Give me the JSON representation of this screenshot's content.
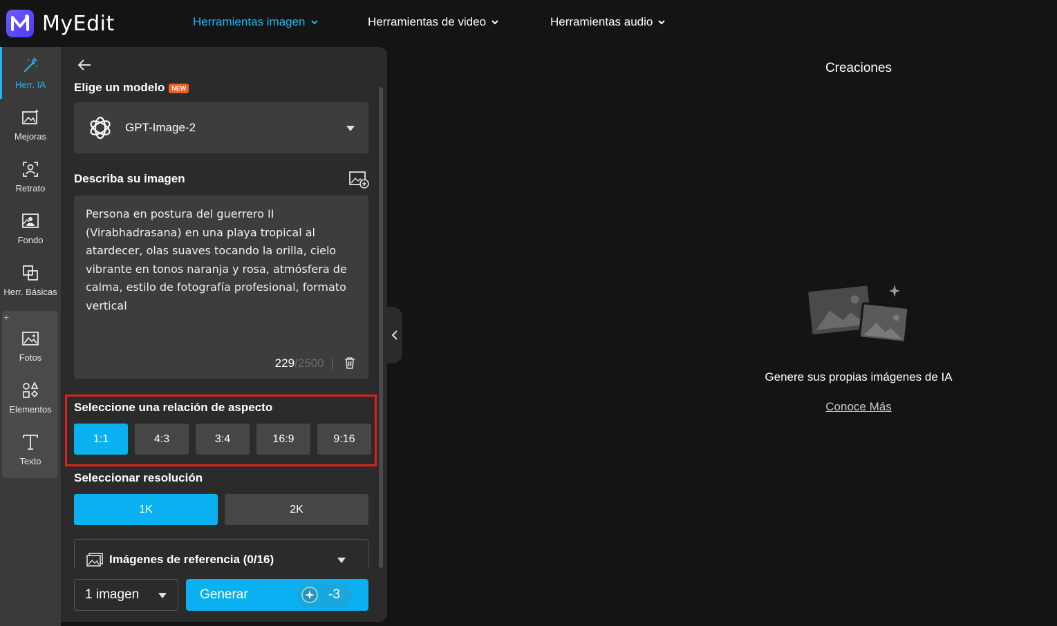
{
  "app": {
    "name": "MyEdit"
  },
  "nav": {
    "items": [
      {
        "label": "Herramientas imagen",
        "active": true
      },
      {
        "label": "Herramientas de video",
        "active": false
      },
      {
        "label": "Herramientas audio",
        "active": false
      }
    ]
  },
  "rail": {
    "items": [
      {
        "label": "Herr. IA",
        "icon": "magic-wand-icon",
        "active": true
      },
      {
        "label": "Mejoras",
        "icon": "image-enhance-icon"
      },
      {
        "label": "Retrato",
        "icon": "portrait-icon"
      },
      {
        "label": "Fondo",
        "icon": "background-icon"
      },
      {
        "label": "Herr. Básicas",
        "icon": "crop-icon"
      },
      {
        "label": "Fotos",
        "icon": "photo-icon"
      },
      {
        "label": "Elementos",
        "icon": "shapes-icon"
      },
      {
        "label": "Texto",
        "icon": "text-icon"
      }
    ],
    "plus": "+"
  },
  "panel": {
    "model_title": "Elige un modelo",
    "new_badge": "NEW",
    "model_selected": "GPT-Image-2",
    "describe_title": "Describa su imagen",
    "prompt": "Persona en postura del guerrero II (Virabhadrasana) en una playa tropical al atardecer, olas suaves tocando la orilla, cielo vibrante en tonos naranja y rosa, atmósfera de calma, estilo de fotografía profesional, formato vertical",
    "char_count": "229",
    "char_max": "/2500",
    "char_sep": "|",
    "aspect_title": "Seleccione una relación de aspecto",
    "aspect_options": [
      "1:1",
      "4:3",
      "3:4",
      "16:9",
      "9:16"
    ],
    "aspect_selected": "1:1",
    "resolution_title": "Seleccionar resolución",
    "resolution_options": [
      "1K",
      "2K"
    ],
    "resolution_selected": "1K",
    "reference_label": "Imágenes de referencia (0/16)",
    "image_count": "1 imagen",
    "generate_label": "Generar",
    "credit_cost": "-3"
  },
  "creations": {
    "title": "Creaciones",
    "empty_text": "Genere sus propias imágenes de IA",
    "learn_more": "Conoce Más"
  },
  "colors": {
    "accent": "#0ab0ef",
    "nav_active": "#24b4ef",
    "highlight_border": "#e02020",
    "new_badge": "#ff5a1f"
  }
}
